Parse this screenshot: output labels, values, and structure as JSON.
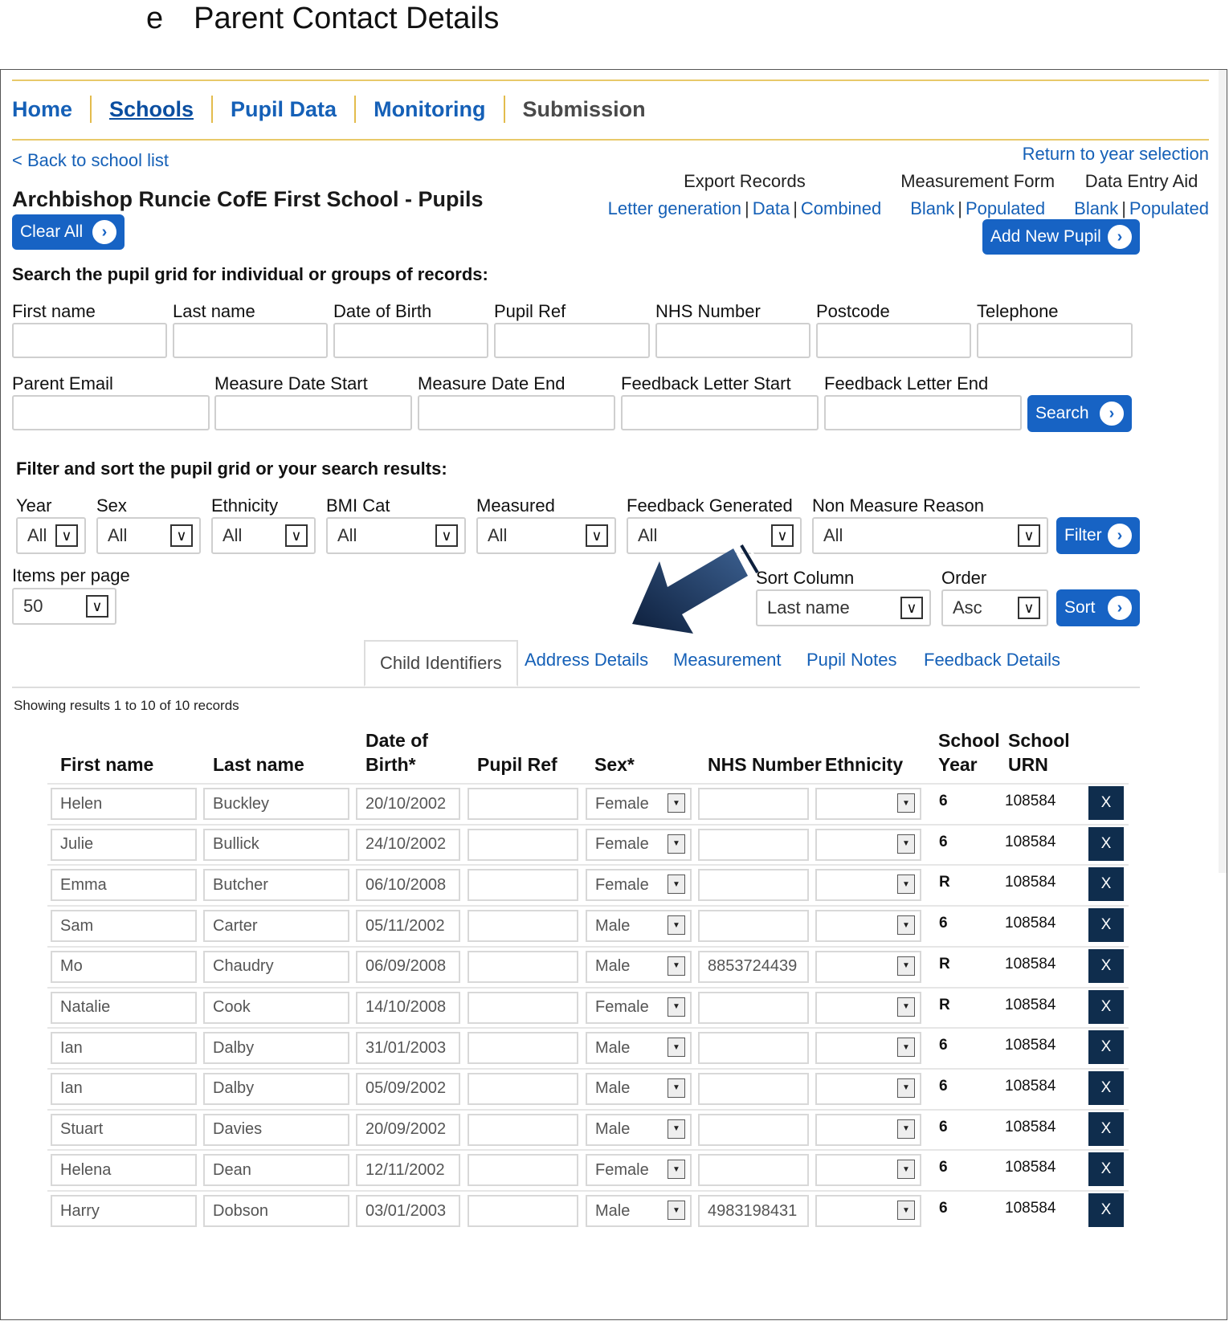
{
  "doc": {
    "letter": "e",
    "heading": "Parent Contact Details"
  },
  "nav": {
    "items": [
      "Home",
      "Schools",
      "Pupil Data",
      "Monitoring",
      "Submission"
    ]
  },
  "links": {
    "back": "< Back to school list",
    "return": "Return to year selection"
  },
  "page_title": "Archbishop Runcie CofE First School - Pupils",
  "exports": {
    "export_records": {
      "title": "Export Records",
      "a": "Letter generation",
      "b": "Data",
      "c": "Combined"
    },
    "measurement_form": {
      "title": "Measurement Form",
      "a": "Blank",
      "b": "Populated"
    },
    "data_entry_aid": {
      "title": "Data Entry Aid",
      "a": "Blank",
      "b": "Populated"
    },
    "sep": "|"
  },
  "buttons": {
    "clear_all": "Clear All",
    "add_new_pupil": "Add New Pupil",
    "search": "Search",
    "filter": "Filter",
    "sort": "Sort"
  },
  "search": {
    "heading": "Search the pupil grid for individual or groups of records:",
    "fields_row1": [
      "First name",
      "Last name",
      "Date of Birth",
      "Pupil Ref",
      "NHS Number",
      "Postcode",
      "Telephone"
    ],
    "fields_row2": [
      "Parent Email",
      "Measure Date Start",
      "Measure Date End",
      "Feedback Letter Start",
      "Feedback Letter End"
    ]
  },
  "filter": {
    "heading": "Filter and sort the pupil grid or your search results:",
    "labels": [
      "Year",
      "Sex",
      "Ethnicity",
      "BMI Cat",
      "Measured",
      "Feedback Generated",
      "Non Measure Reason"
    ],
    "value": "All",
    "items_per_page_label": "Items per page",
    "items_per_page": "50",
    "sort_column_label": "Sort Column",
    "sort_column": "Last name",
    "order_label": "Order",
    "order": "Asc"
  },
  "tabs": [
    "Child Identifiers",
    "Address Details",
    "Measurement",
    "Pupil Notes",
    "Feedback Details"
  ],
  "showing": "Showing results 1 to 10 of 10 records",
  "table": {
    "headers": {
      "first": "First name",
      "last": "Last name",
      "dob1": "Date of",
      "dob2": "Birth*",
      "ref": "Pupil Ref",
      "sex": "Sex*",
      "nhs": "NHS Number",
      "eth": "Ethnicity",
      "year1": "School",
      "year2": "Year",
      "urn1": "School",
      "urn2": "URN"
    },
    "rows": [
      {
        "first": "Helen",
        "last": "Buckley",
        "dob": "20/10/2002",
        "ref": "",
        "sex": "Female",
        "nhs": "",
        "eth": "",
        "year": "6",
        "urn": "108584",
        "x": "X"
      },
      {
        "first": "Julie",
        "last": "Bullick",
        "dob": "24/10/2002",
        "ref": "",
        "sex": "Female",
        "nhs": "",
        "eth": "",
        "year": "6",
        "urn": "108584",
        "x": "X"
      },
      {
        "first": "Emma",
        "last": "Butcher",
        "dob": "06/10/2008",
        "ref": "",
        "sex": "Female",
        "nhs": "",
        "eth": "",
        "year": "R",
        "urn": "108584",
        "x": "X"
      },
      {
        "first": "Sam",
        "last": "Carter",
        "dob": "05/11/2002",
        "ref": "",
        "sex": "Male",
        "nhs": "",
        "eth": "",
        "year": "6",
        "urn": "108584",
        "x": "X"
      },
      {
        "first": "Mo",
        "last": "Chaudry",
        "dob": "06/09/2008",
        "ref": "",
        "sex": "Male",
        "nhs": "8853724439",
        "eth": "",
        "year": "R",
        "urn": "108584",
        "x": "X"
      },
      {
        "first": "Natalie",
        "last": "Cook",
        "dob": "14/10/2008",
        "ref": "",
        "sex": "Female",
        "nhs": "",
        "eth": "",
        "year": "R",
        "urn": "108584",
        "x": "X"
      },
      {
        "first": "Ian",
        "last": "Dalby",
        "dob": "31/01/2003",
        "ref": "",
        "sex": "Male",
        "nhs": "",
        "eth": "",
        "year": "6",
        "urn": "108584",
        "x": "X"
      },
      {
        "first": "Ian",
        "last": "Dalby",
        "dob": "05/09/2002",
        "ref": "",
        "sex": "Male",
        "nhs": "",
        "eth": "",
        "year": "6",
        "urn": "108584",
        "x": "X"
      },
      {
        "first": "Stuart",
        "last": "Davies",
        "dob": "20/09/2002",
        "ref": "",
        "sex": "Male",
        "nhs": "",
        "eth": "",
        "year": "6",
        "urn": "108584",
        "x": "X"
      },
      {
        "first": "Helena",
        "last": "Dean",
        "dob": "12/11/2002",
        "ref": "",
        "sex": "Female",
        "nhs": "",
        "eth": "",
        "year": "6",
        "urn": "108584",
        "x": "X"
      },
      {
        "first": "Harry",
        "last": "Dobson",
        "dob": "03/01/2003",
        "ref": "",
        "sex": "Male",
        "nhs": "4983198431",
        "eth": "",
        "year": "6",
        "urn": "108584",
        "x": "X"
      }
    ]
  },
  "icons": {
    "chevron": "chevron-right-icon",
    "dropdown": "chevron-down-icon",
    "arrow": "pointer-arrow-icon"
  },
  "colors": {
    "brand_blue": "#1763c4",
    "link_blue": "#1560b7",
    "nav_rule": "#e8c96a",
    "delete_button": "#0f2d4d"
  }
}
